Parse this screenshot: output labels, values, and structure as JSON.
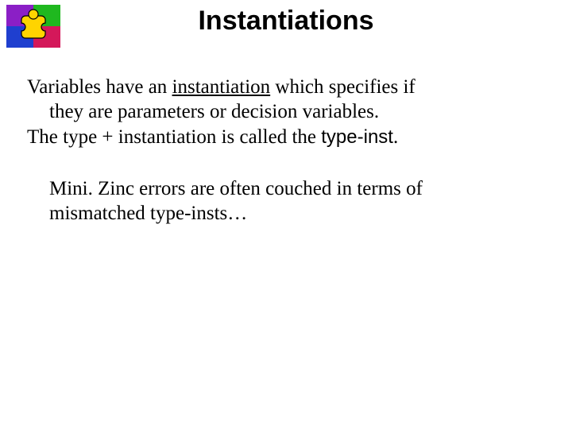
{
  "title": "Instantiations",
  "p1_line1_a": "Variables have an ",
  "p1_line1_b": "instantiation",
  "p1_line1_c": " which specifies if",
  "p1_line2": "they are parameters or decision variables.",
  "p2_a": "The type + instantiation is called the ",
  "p2_b": "type-inst",
  "p2_c": ".",
  "p3_line1": "Mini. Zinc errors are often couched in terms of",
  "p3_line2": "mismatched type-insts…"
}
